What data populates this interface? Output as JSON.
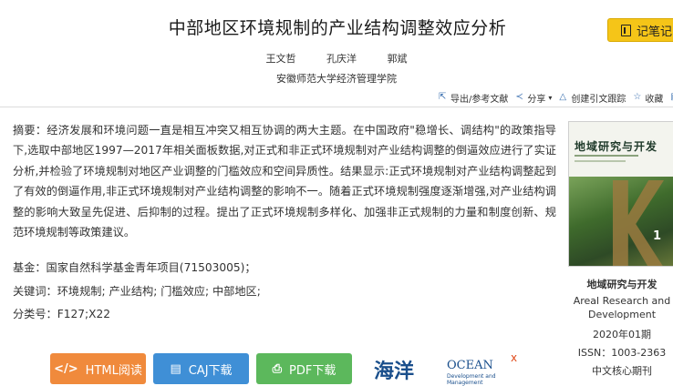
{
  "title": "中部地区环境规制的产业结构调整效应分析",
  "note_button": {
    "label": "记笔记"
  },
  "authors": [
    "王文哲",
    "孔庆洋",
    "郭斌"
  ],
  "affiliation": "安徽师范大学经济管理学院",
  "toolbar": {
    "export": "导出/参考文献",
    "share": "分享",
    "track": "创建引文跟踪",
    "favorite": "收藏",
    "print": "打"
  },
  "abstract": "摘要：经济发展和环境问题一直是相互冲突又相互协调的两大主题。在中国政府\"稳增长、调结构\"的政策指导下,选取中部地区1997—2017年相关面板数据,对正式和非正式环境规制对产业结构调整的倒逼效应进行了实证分析,并检验了环境规制对地区产业调整的门槛效应和空间异质性。结果显示:正式环境规制对产业结构调整起到了有效的倒逼作用,非正式环境规制对产业结构调整的影响不一。随着正式环境规制强度逐渐增强,对产业结构调整的影响大致呈先促进、后抑制的过程。提出了正式环境规制多样化、加强非正式规制的力量和制度创新、规范环境规制等政策建议。",
  "fund": "基金：国家自然科学基金青年项目(71503005)；",
  "keywords": "关键词：环境规制; 产业结构; 门槛效应; 中部地区;",
  "classification": "分类号：F127;X22",
  "journal": {
    "cover_title": "地域研究与开发",
    "cover_issue": "1",
    "name": "地域研究与开发",
    "name_en_1": "Areal Research and",
    "name_en_2": "Development",
    "issue": "2020年01期",
    "issn": "ISSN：1003-2363",
    "tag": "中文核心期刊"
  },
  "buttons": {
    "html": "HTML阅读",
    "caj": "CAJ下载",
    "pdf": "PDF下载"
  },
  "ad": {
    "logo_cn": "海洋",
    "logo_en": "OCEAN",
    "logo_en_sub": "Development and Management",
    "close": "x"
  },
  "colors": {
    "note_button": "#f5c518",
    "html_button": "#f08a3c",
    "caj_button": "#3f8fd6",
    "pdf_button": "#5cb85c"
  }
}
